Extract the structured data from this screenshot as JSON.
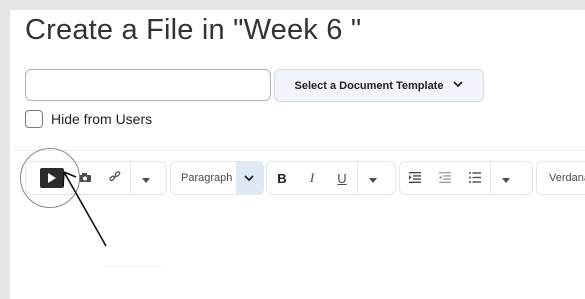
{
  "page": {
    "title": "Create a File in \"Week 6 \""
  },
  "file_name": {
    "value": "",
    "placeholder": ""
  },
  "template_button": {
    "label": "Select a Document Template",
    "chevron": "chevron-down-icon"
  },
  "hide_from_users": {
    "label": "Hide from Users",
    "checked": false
  },
  "toolbar": {
    "insert_stuff_icon": "play-icon",
    "insert_image_icon": "camera-icon",
    "insert_link_icon": "link-icon",
    "more_icon": "caret-down-icon",
    "paragraph_label": "Paragraph",
    "bold_label": "B",
    "italic_label": "I",
    "underline_label": "U",
    "format_more_icon": "caret-down-icon",
    "align_left_icon": "indent-icon",
    "align_center_icon": "outdent-icon",
    "bullets_icon": "bulleted-list-icon",
    "list_more_icon": "caret-down-icon",
    "font_label": "Verdana"
  },
  "annotation": {
    "highlight": "circle-around-insert-stuff",
    "pointer": "arrow-icon"
  }
}
